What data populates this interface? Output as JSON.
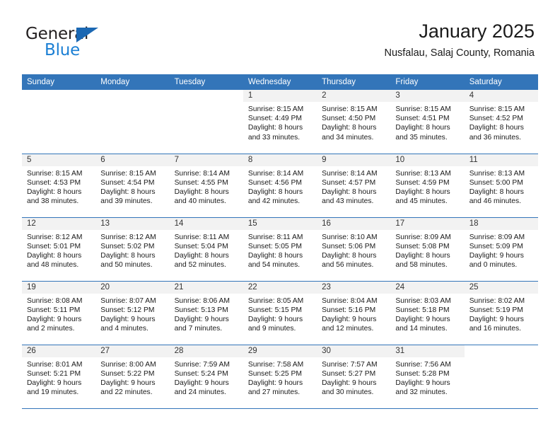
{
  "brand": {
    "word_one": "General",
    "word_two": "Blue",
    "triangle_color": "#1b68b3",
    "blue_color": "#1b7fd4"
  },
  "header": {
    "title": "January 2025",
    "subtitle": "Nusfalau, Salaj County, Romania"
  },
  "colors": {
    "header_row": "#3375b9",
    "daynum_bar": "#f2f2f2",
    "row_divider": "#3375b9"
  },
  "weekday_headers": [
    "Sunday",
    "Monday",
    "Tuesday",
    "Wednesday",
    "Thursday",
    "Friday",
    "Saturday"
  ],
  "weeks": [
    [
      {
        "day": "",
        "sunrise": "",
        "sunset": "",
        "daylight_line1": "",
        "daylight_line2": "",
        "state": "blank"
      },
      {
        "day": "",
        "sunrise": "",
        "sunset": "",
        "daylight_line1": "",
        "daylight_line2": "",
        "state": "blank"
      },
      {
        "day": "",
        "sunrise": "",
        "sunset": "",
        "daylight_line1": "",
        "daylight_line2": "",
        "state": "blank"
      },
      {
        "day": "1",
        "sunrise": "Sunrise: 8:15 AM",
        "sunset": "Sunset: 4:49 PM",
        "daylight_line1": "Daylight: 8 hours",
        "daylight_line2": "and 33 minutes.",
        "state": "filled"
      },
      {
        "day": "2",
        "sunrise": "Sunrise: 8:15 AM",
        "sunset": "Sunset: 4:50 PM",
        "daylight_line1": "Daylight: 8 hours",
        "daylight_line2": "and 34 minutes.",
        "state": "filled"
      },
      {
        "day": "3",
        "sunrise": "Sunrise: 8:15 AM",
        "sunset": "Sunset: 4:51 PM",
        "daylight_line1": "Daylight: 8 hours",
        "daylight_line2": "and 35 minutes.",
        "state": "filled"
      },
      {
        "day": "4",
        "sunrise": "Sunrise: 8:15 AM",
        "sunset": "Sunset: 4:52 PM",
        "daylight_line1": "Daylight: 8 hours",
        "daylight_line2": "and 36 minutes.",
        "state": "filled"
      }
    ],
    [
      {
        "day": "5",
        "sunrise": "Sunrise: 8:15 AM",
        "sunset": "Sunset: 4:53 PM",
        "daylight_line1": "Daylight: 8 hours",
        "daylight_line2": "and 38 minutes.",
        "state": "filled"
      },
      {
        "day": "6",
        "sunrise": "Sunrise: 8:15 AM",
        "sunset": "Sunset: 4:54 PM",
        "daylight_line1": "Daylight: 8 hours",
        "daylight_line2": "and 39 minutes.",
        "state": "filled"
      },
      {
        "day": "7",
        "sunrise": "Sunrise: 8:14 AM",
        "sunset": "Sunset: 4:55 PM",
        "daylight_line1": "Daylight: 8 hours",
        "daylight_line2": "and 40 minutes.",
        "state": "filled"
      },
      {
        "day": "8",
        "sunrise": "Sunrise: 8:14 AM",
        "sunset": "Sunset: 4:56 PM",
        "daylight_line1": "Daylight: 8 hours",
        "daylight_line2": "and 42 minutes.",
        "state": "filled"
      },
      {
        "day": "9",
        "sunrise": "Sunrise: 8:14 AM",
        "sunset": "Sunset: 4:57 PM",
        "daylight_line1": "Daylight: 8 hours",
        "daylight_line2": "and 43 minutes.",
        "state": "filled"
      },
      {
        "day": "10",
        "sunrise": "Sunrise: 8:13 AM",
        "sunset": "Sunset: 4:59 PM",
        "daylight_line1": "Daylight: 8 hours",
        "daylight_line2": "and 45 minutes.",
        "state": "filled"
      },
      {
        "day": "11",
        "sunrise": "Sunrise: 8:13 AM",
        "sunset": "Sunset: 5:00 PM",
        "daylight_line1": "Daylight: 8 hours",
        "daylight_line2": "and 46 minutes.",
        "state": "filled"
      }
    ],
    [
      {
        "day": "12",
        "sunrise": "Sunrise: 8:12 AM",
        "sunset": "Sunset: 5:01 PM",
        "daylight_line1": "Daylight: 8 hours",
        "daylight_line2": "and 48 minutes.",
        "state": "filled"
      },
      {
        "day": "13",
        "sunrise": "Sunrise: 8:12 AM",
        "sunset": "Sunset: 5:02 PM",
        "daylight_line1": "Daylight: 8 hours",
        "daylight_line2": "and 50 minutes.",
        "state": "filled"
      },
      {
        "day": "14",
        "sunrise": "Sunrise: 8:11 AM",
        "sunset": "Sunset: 5:04 PM",
        "daylight_line1": "Daylight: 8 hours",
        "daylight_line2": "and 52 minutes.",
        "state": "filled"
      },
      {
        "day": "15",
        "sunrise": "Sunrise: 8:11 AM",
        "sunset": "Sunset: 5:05 PM",
        "daylight_line1": "Daylight: 8 hours",
        "daylight_line2": "and 54 minutes.",
        "state": "filled"
      },
      {
        "day": "16",
        "sunrise": "Sunrise: 8:10 AM",
        "sunset": "Sunset: 5:06 PM",
        "daylight_line1": "Daylight: 8 hours",
        "daylight_line2": "and 56 minutes.",
        "state": "filled"
      },
      {
        "day": "17",
        "sunrise": "Sunrise: 8:09 AM",
        "sunset": "Sunset: 5:08 PM",
        "daylight_line1": "Daylight: 8 hours",
        "daylight_line2": "and 58 minutes.",
        "state": "filled"
      },
      {
        "day": "18",
        "sunrise": "Sunrise: 8:09 AM",
        "sunset": "Sunset: 5:09 PM",
        "daylight_line1": "Daylight: 9 hours",
        "daylight_line2": "and 0 minutes.",
        "state": "filled"
      }
    ],
    [
      {
        "day": "19",
        "sunrise": "Sunrise: 8:08 AM",
        "sunset": "Sunset: 5:11 PM",
        "daylight_line1": "Daylight: 9 hours",
        "daylight_line2": "and 2 minutes.",
        "state": "filled"
      },
      {
        "day": "20",
        "sunrise": "Sunrise: 8:07 AM",
        "sunset": "Sunset: 5:12 PM",
        "daylight_line1": "Daylight: 9 hours",
        "daylight_line2": "and 4 minutes.",
        "state": "filled"
      },
      {
        "day": "21",
        "sunrise": "Sunrise: 8:06 AM",
        "sunset": "Sunset: 5:13 PM",
        "daylight_line1": "Daylight: 9 hours",
        "daylight_line2": "and 7 minutes.",
        "state": "filled"
      },
      {
        "day": "22",
        "sunrise": "Sunrise: 8:05 AM",
        "sunset": "Sunset: 5:15 PM",
        "daylight_line1": "Daylight: 9 hours",
        "daylight_line2": "and 9 minutes.",
        "state": "filled"
      },
      {
        "day": "23",
        "sunrise": "Sunrise: 8:04 AM",
        "sunset": "Sunset: 5:16 PM",
        "daylight_line1": "Daylight: 9 hours",
        "daylight_line2": "and 12 minutes.",
        "state": "filled"
      },
      {
        "day": "24",
        "sunrise": "Sunrise: 8:03 AM",
        "sunset": "Sunset: 5:18 PM",
        "daylight_line1": "Daylight: 9 hours",
        "daylight_line2": "and 14 minutes.",
        "state": "filled"
      },
      {
        "day": "25",
        "sunrise": "Sunrise: 8:02 AM",
        "sunset": "Sunset: 5:19 PM",
        "daylight_line1": "Daylight: 9 hours",
        "daylight_line2": "and 16 minutes.",
        "state": "filled"
      }
    ],
    [
      {
        "day": "26",
        "sunrise": "Sunrise: 8:01 AM",
        "sunset": "Sunset: 5:21 PM",
        "daylight_line1": "Daylight: 9 hours",
        "daylight_line2": "and 19 minutes.",
        "state": "filled"
      },
      {
        "day": "27",
        "sunrise": "Sunrise: 8:00 AM",
        "sunset": "Sunset: 5:22 PM",
        "daylight_line1": "Daylight: 9 hours",
        "daylight_line2": "and 22 minutes.",
        "state": "filled"
      },
      {
        "day": "28",
        "sunrise": "Sunrise: 7:59 AM",
        "sunset": "Sunset: 5:24 PM",
        "daylight_line1": "Daylight: 9 hours",
        "daylight_line2": "and 24 minutes.",
        "state": "filled"
      },
      {
        "day": "29",
        "sunrise": "Sunrise: 7:58 AM",
        "sunset": "Sunset: 5:25 PM",
        "daylight_line1": "Daylight: 9 hours",
        "daylight_line2": "and 27 minutes.",
        "state": "filled"
      },
      {
        "day": "30",
        "sunrise": "Sunrise: 7:57 AM",
        "sunset": "Sunset: 5:27 PM",
        "daylight_line1": "Daylight: 9 hours",
        "daylight_line2": "and 30 minutes.",
        "state": "filled"
      },
      {
        "day": "31",
        "sunrise": "Sunrise: 7:56 AM",
        "sunset": "Sunset: 5:28 PM",
        "daylight_line1": "Daylight: 9 hours",
        "daylight_line2": "and 32 minutes.",
        "state": "filled"
      },
      {
        "day": "",
        "sunrise": "",
        "sunset": "",
        "daylight_line1": "",
        "daylight_line2": "",
        "state": "blank"
      }
    ]
  ]
}
